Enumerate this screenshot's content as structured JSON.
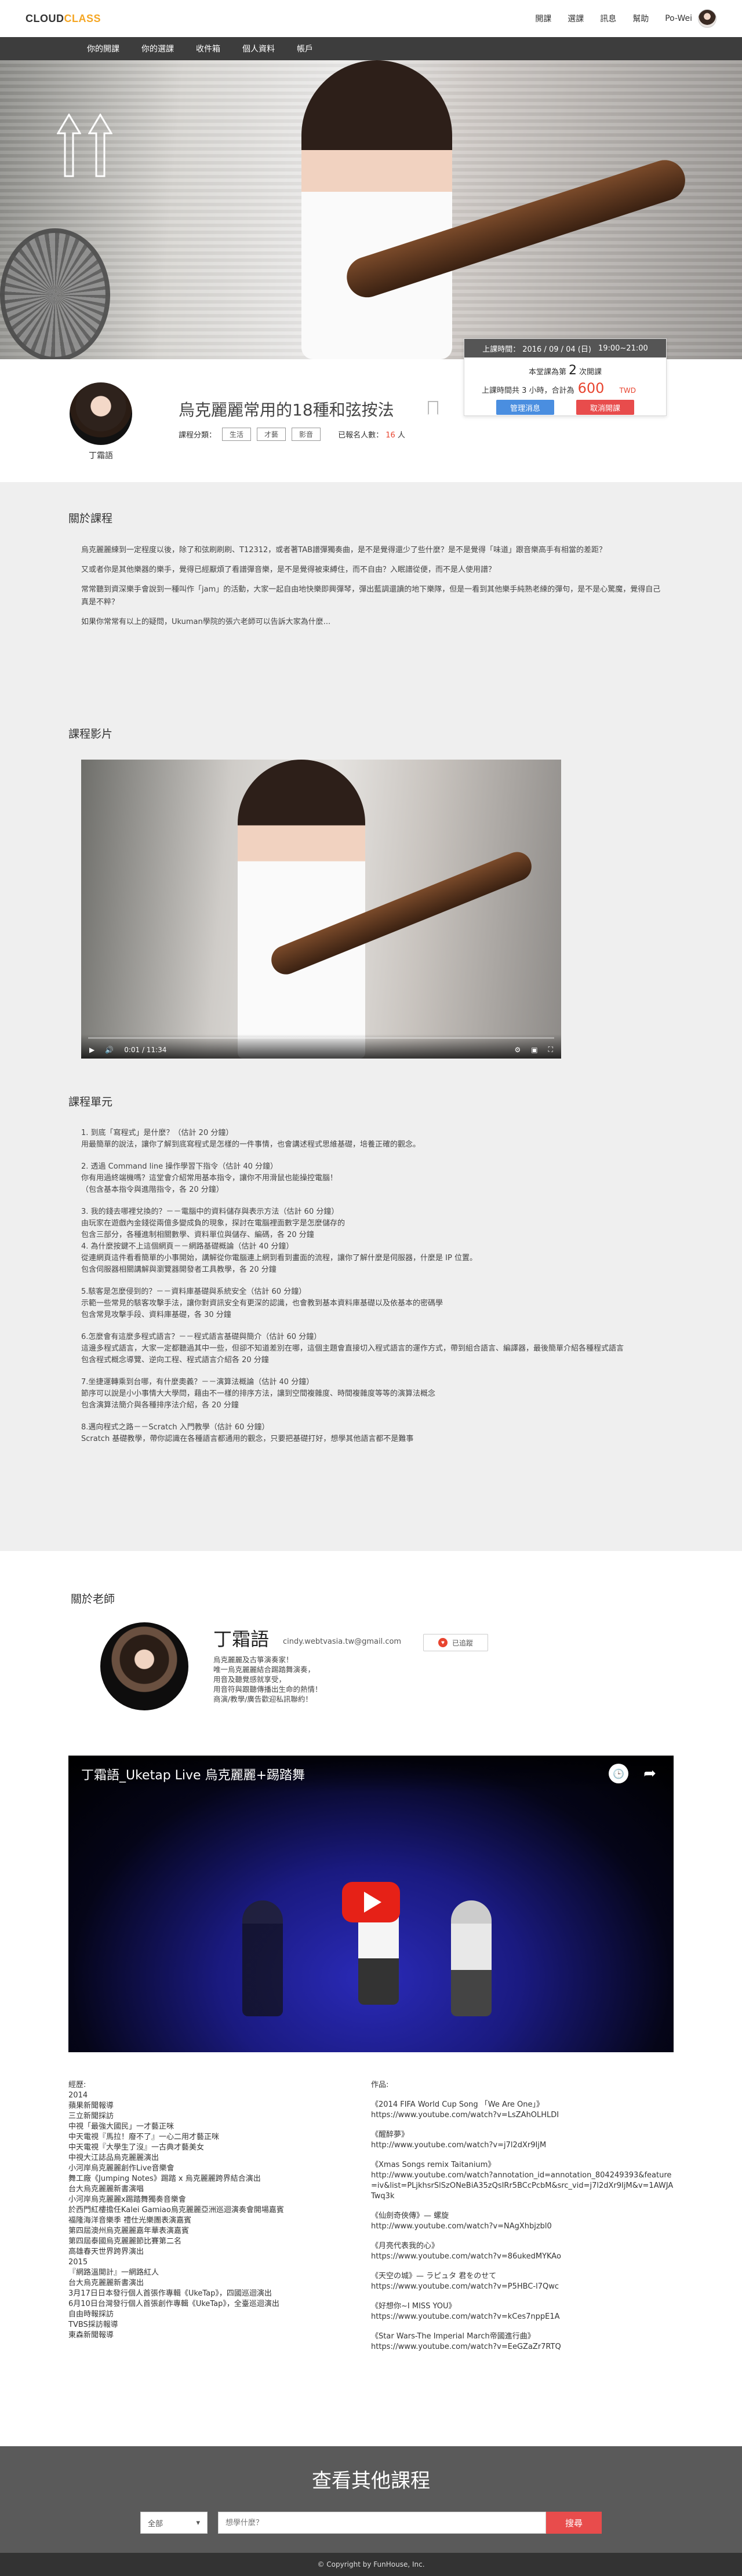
{
  "brand": {
    "part1": "CLOUD",
    "part2": "CLASS"
  },
  "topnav": {
    "items": [
      "開課",
      "選課",
      "訊息",
      "幫助"
    ],
    "username": "Po-Wei"
  },
  "subnav": [
    "你的開課",
    "你的選課",
    "收件箱",
    "個人資料",
    "帳戶"
  ],
  "time_card": {
    "label": "上課時間：",
    "date": "2016 / 09 / 04 (日)",
    "time": "19:00~21:00",
    "line1_prefix": "本堂課為第",
    "line1_num": "2",
    "line1_suffix": "次開課",
    "line2_prefix": "上課時間共 3 小時，合計為",
    "price": "600",
    "currency": "TWD",
    "primary_btn": "管理消息",
    "cancel_btn": "取消開課"
  },
  "course": {
    "teacher_name": "丁霜語",
    "title": "烏克麗麗常用的18種和弦按法",
    "category_label": "課程分類：",
    "tags": [
      "生活",
      "才藝",
      "影音"
    ],
    "enroll_prefix": "已報名人數：",
    "enroll_count": "16",
    "enroll_suffix": "人"
  },
  "about": {
    "title": "關於課程",
    "paragraphs": [
      "烏克麗麗練到一定程度以後，除了和弦刷刷刷、T12312，或者著TAB譜彈獨奏曲，是不是覺得還少了些什麼？是不是覺得「味道」跟音樂高手有相當的差距？",
      "又或者你是其他樂器的樂手，覺得已經厭煩了看譜彈音樂，是不是覺得被束縛住，而不自由？入眠譜從便，而不是人使用譜？",
      "常常聽到資深樂手會說到一種叫作「jam」的活動，大家一起自由地快樂即興彈琴，彈出藍調還讀的地下樂隊，但是一看到其他樂手純熟老練的彈句，是不是心驚魔，覺得自己真是不粹？",
      "如果你常常有以上的疑問，Ukuman學院的張六老師可以告訴大家為什麼..."
    ]
  },
  "video_section": {
    "title": "課程影片",
    "time": "0:01 / 11:34"
  },
  "units": {
    "title": "課程單元",
    "items": [
      {
        "head": "1. 到底「寫程式」是什麼？（估計 20 分鐘）",
        "body": [
          "用最簡單的說法，讓你了解到底寫程式是怎樣的一件事情，也會講述程式思維基礎，培養正確的觀念。"
        ]
      },
      {
        "head": "2. 透過 Command line 操作學習下指令（估計 40 分鐘）",
        "body": [
          "你有用過終端機嗎？這堂會介紹常用基本指令，讓你不用滑鼠也能操控電腦！",
          "（包含基本指令與進階指令，各 20 分鐘）"
        ]
      },
      {
        "head": "3. 我的錢去哪裡兌換的？－－電腦中的資料儲存與表示方法（估計 60 分鐘）",
        "body": [
          "由玩家在遊戲內金錢從兩億多變成負的現象，探討在電腦裡面數字是怎麼儲存的",
          "包含三部分，各種進制相關數學、資料單位與儲存、編碼，各 20 分鐘",
          "4. 為什麼按鍵不上這個網頁－－網路基礎概論（估計 40 分鐘）",
          "從連網頁這件看看簡單的小事開始，講解從你電腦連上網到看到畫面的流程，讓你了解什麼是伺服器，什麼是 IP 位置。",
          "包含伺服器相關講解與瀏覽器開發者工具教學，各 20 分鐘"
        ]
      },
      {
        "head": "5.駭客是怎麼侵到的？－－資料庫基礎與系統安全（估計 60 分鐘）",
        "body": [
          "示範一些常見的駭客攻擊手法，讓你對資訊安全有更深的認識，也會教到基本資料庫基礎以及依基本的密碼學",
          "包含常見攻擊手段、資料庫基礎，各 30 分鐘"
        ]
      },
      {
        "head": "6.怎麼會有這麼多程式語言？－－程式語言基礎與簡介（估計 60 分鐘）",
        "body": [
          "這邊多程式語言，大家一定都聽過其中一些，但卻不知道差別在哪，這個主題會直接切入程式語言的運作方式，帶到組合語言、編譯器，最後簡單介紹各種程式語言",
          "包含程式概念導覽、逆向工程、程式語言介紹各 20 分鐘"
        ]
      },
      {
        "head": "7.坐捷運轉乘到台哪，有什麼奧義？－－演算法概論（估計 40 分鐘）",
        "body": [
          "節序可以說是小小事情大大學問，藉由不一樣的排序方法，讓到空間複雜度、時間複雜度等等的演算法概念",
          "包含演算法簡介與各種排序法介紹，各 20 分鐘"
        ]
      },
      {
        "head": "8.邁向程式之路－－Scratch 入門教學（估計 60 分鐘）",
        "body": [
          "Scratch 基礎教學，帶你認識在各種語言都通用的觀念，只要把基礎打好，想學其他語言都不是難事"
        ]
      }
    ]
  },
  "teacher": {
    "section_title": "關於老師",
    "name": "丁霜語",
    "email": "cindy.webtvasia.tw@gmail.com",
    "follow_label": "已追蹤",
    "bio": [
      "烏克麗麗及古箏演奏家！",
      "唯一烏克麗麗結合踢踏舞演奏，",
      "用音及聽覺感就享受，",
      "用音符與跟聽傳播出生命的熱情！",
      "商演/教學/廣告歡迎私訊聯約！"
    ],
    "video_title": "丁霜語_Uketap Live 烏克麗麗+踢踏舞",
    "experience": [
      "經歷:",
      "2014",
      "蘋果新聞報導",
      "三立新聞採訪",
      "中視「最強大國民」一才藝正咪",
      "中天電視『馬拉！廢不了』一心二用才藝正咪",
      "中天電視『大學生了沒』一古典才藝美女",
      "中視大江誌品烏克麗麗演出",
      "小河岸烏克麗麗創作Live音樂會",
      "舞工廠《Jumping Notes》踢踏 x 烏克麗麗跨界結合演出",
      "台大烏克麗麗新書演唱",
      "小河岸烏克麗麗x踢踏舞獨奏音樂會",
      "於西門紅樓擔任Kalei Gamiao烏克麗麗亞洲巡迴演奏會開場嘉賓",
      "福隆海洋音樂季 禮仕光樂團表演嘉賓",
      "第四屆澳州烏克麗麗嘉年華表演嘉賓",
      "第四屆泰國烏克麗麗節比賽第二名",
      "高雄春天世界跨界演出",
      "2015",
      "『網路溫開計』一網路紅人",
      "台大烏克麗麗新書演出",
      "3月17日日本發行個人首張作專輯《UkeTap》，四國巡迴演出",
      "6月10日台灣發行個人首張創作專輯《UkeTap》，全臺巡迴演出",
      "自由時報採訪",
      "TVBS採訪報導",
      "東森新聞報導"
    ],
    "works": [
      {
        "t": "作品:",
        "u": ""
      },
      {
        "t": "《2014 FIFA World Cup Song 「We Are One」》",
        "u": "https://www.youtube.com/watch?v=LsZAhOLHLDI"
      },
      {
        "t": "《醒醉夢》",
        "u": "http://www.youtube.com/watch?v=j7l2dXr9IjM"
      },
      {
        "t": "《Xmas Songs remix Taitanium》",
        "u": "http://www.youtube.com/watch?annotation_id=annotation_804249393&feature=iv&list=PLjkhsrSlSzONeBiA35zQsIRr5BCcPcbM&src_vid=j7l2dXr9IjM&v=1AWJATwq3k"
      },
      {
        "t": "《仙劍奇俠傳》— 螺旋",
        "u": "http://www.youtube.com/watch?v=NAgXhbjzbl0"
      },
      {
        "t": "《月亮代表我的心》",
        "u": "https://www.youtube.com/watch?v=86ukedMYKAo"
      },
      {
        "t": "《天空の城》— ラピュタ 君をのせて",
        "u": "https://www.youtube.com/watch?v=P5HBC-l7Qwc"
      },
      {
        "t": "《好想你~I MISS YOU》",
        "u": "https://www.youtube.com/watch?v=kCes7nppE1A"
      },
      {
        "t": "《Star Wars-The Imperial March帝國進行曲》",
        "u": "https://www.youtube.com/watch?v=EeGZaZr7RTQ"
      }
    ]
  },
  "more": {
    "title": "查看其他課程",
    "select": "全部",
    "placeholder": "想學什麼？",
    "search_btn": "搜尋"
  },
  "footer": "© Copyright by FunHouse, Inc.",
  "colors": {
    "accent": "#f5a623",
    "danger": "#e84c4c",
    "primary": "#4a8ee0"
  }
}
